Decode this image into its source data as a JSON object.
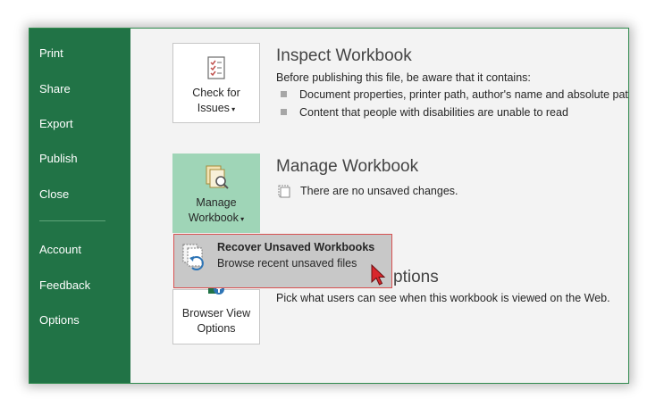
{
  "sidebar": {
    "items": [
      {
        "id": "print",
        "label": "Print"
      },
      {
        "id": "share",
        "label": "Share"
      },
      {
        "id": "export",
        "label": "Export"
      },
      {
        "id": "publish",
        "label": "Publish"
      },
      {
        "id": "close",
        "label": "Close"
      },
      {
        "id": "account",
        "label": "Account"
      },
      {
        "id": "feedback",
        "label": "Feedback"
      },
      {
        "id": "options",
        "label": "Options"
      }
    ]
  },
  "inspect": {
    "button_line1": "Check for",
    "button_line2": "Issues",
    "title": "Inspect Workbook",
    "desc": "Before publishing this file, be aware that it contains:",
    "bullets": [
      "Document properties, printer path, author's name and absolute pat",
      "Content that people with disabilities are unable to read"
    ]
  },
  "manage": {
    "button_line1": "Manage",
    "button_line2": "Workbook",
    "title": "Manage Workbook",
    "status": "There are no unsaved changes."
  },
  "browser": {
    "button_line1": "Browser View",
    "button_line2": "Options",
    "title_partial": "ptions",
    "desc": "Pick what users can see when this workbook is viewed on the Web."
  },
  "popup": {
    "title": "Recover Unsaved Workbooks",
    "subtitle": "Browse recent unsaved files"
  },
  "colors": {
    "sidebar": "#217346",
    "active_button": "#9fd5b7",
    "popup_border": "#d75151",
    "cursor": "#d9262c"
  }
}
